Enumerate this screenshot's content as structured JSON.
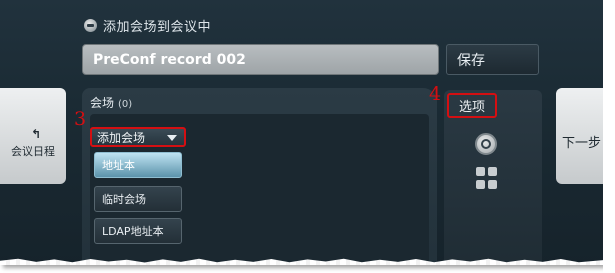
{
  "window": {
    "title": "添加会场到会议中",
    "icon": "app-logo-icon"
  },
  "conference": {
    "name_value": "PreConf record 002",
    "save_label": "保存"
  },
  "nav": {
    "back_label": "会议日程",
    "back_icon": "undo-arrow-icon",
    "back_glyph": "↰",
    "next_label": "下一步"
  },
  "venues": {
    "title": "会场",
    "count": "(0)",
    "add_label": "添加会场",
    "menu_items": [
      {
        "label": "地址本",
        "selected": true
      },
      {
        "label": "临时会场",
        "selected": false
      },
      {
        "label": "LDAP地址本",
        "selected": false
      }
    ]
  },
  "options": {
    "tab_label": "选项",
    "icons": [
      "dial-icon",
      "grid-icon"
    ]
  },
  "annotations": {
    "step3": "3",
    "step4": "4"
  },
  "colors": {
    "annotation_red": "#d40f12",
    "selected_item": "#8fc4d9",
    "background": "#1a2a33"
  }
}
